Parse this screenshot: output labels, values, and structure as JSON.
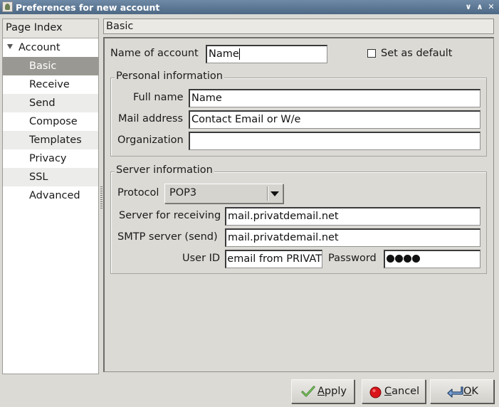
{
  "window": {
    "title": "Preferences for new account",
    "controls": [
      "∨",
      "∧",
      "✕"
    ]
  },
  "sidebar": {
    "header": "Page Index",
    "parent": "Account",
    "items": [
      "Basic",
      "Receive",
      "Send",
      "Compose",
      "Templates",
      "Privacy",
      "SSL",
      "Advanced"
    ],
    "selected": "Basic"
  },
  "page": {
    "header": "Basic",
    "account_name_label": "Name of account",
    "account_name_value": "Name",
    "set_default_label": "Set as default",
    "set_default_checked": false,
    "personal": {
      "legend": "Personal information",
      "full_name_label": "Full name",
      "full_name_value": "Name",
      "mail_label": "Mail address",
      "mail_value": "Contact Email or W/e",
      "org_label": "Organization",
      "org_value": ""
    },
    "server": {
      "legend": "Server information",
      "protocol_label": "Protocol",
      "protocol_value": "POP3",
      "receive_label": "Server for receiving",
      "receive_value": "mail.privatdemail.net",
      "smtp_label": "SMTP server (send)",
      "smtp_value": "mail.privatdemail.net",
      "userid_label": "User ID",
      "userid_value": "email from PRIVAT",
      "password_label": "Password",
      "password_length": 4
    }
  },
  "buttons": {
    "apply": "Apply",
    "cancel": "Cancel",
    "ok": "OK"
  },
  "colors": {
    "titlebar": "#5d7894",
    "selected_item": "#9a9892",
    "window_bg": "#dcdad5"
  }
}
